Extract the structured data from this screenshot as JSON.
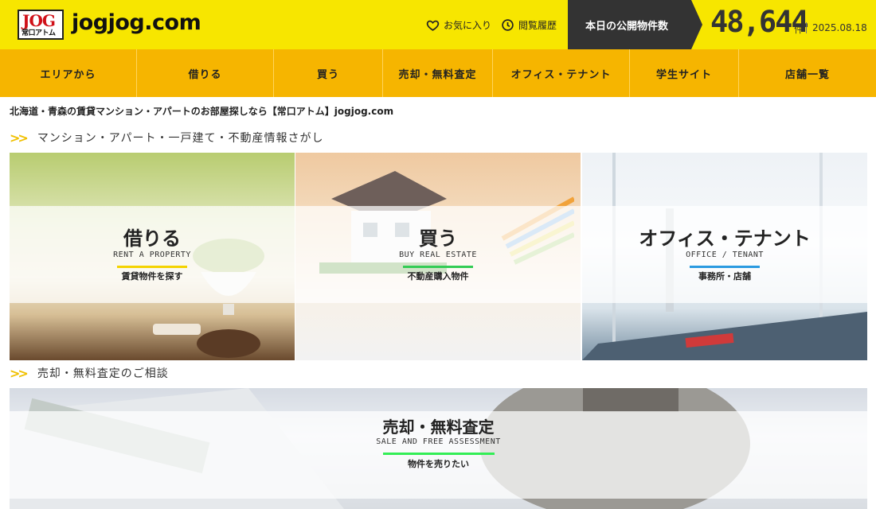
{
  "header": {
    "logo_text": "JOG",
    "logo_sub": "常口アトム",
    "site_name": "jogjog.com",
    "favorites": "お気に入り",
    "history": "閲覧履歴",
    "count_label": "本日の公開物件数",
    "count_value": "48,644",
    "count_unit": "件",
    "date": "2025.08.18"
  },
  "nav": [
    {
      "label": "エリアから"
    },
    {
      "label": "借りる"
    },
    {
      "label": "買う"
    },
    {
      "label": "売却・無料査定"
    },
    {
      "label": "オフィス・テナント"
    },
    {
      "label": "学生サイト"
    },
    {
      "label": "店舗一覧"
    }
  ],
  "lead": "北海道・青森の賃貸マンション・アパートのお部屋探しなら【常口アトム】jogjog.com",
  "section1": {
    "title": "マンション・アパート・一戸建て・不動産情報さがし"
  },
  "panels": [
    {
      "title": "借りる",
      "sub": "RENT A PROPERTY",
      "desc": "賃貸物件を探す",
      "bar_color": "#f4d300"
    },
    {
      "title": "買う",
      "sub": "BUY REAL ESTATE",
      "desc": "不動産購入物件",
      "bar_color": "#33cc55"
    },
    {
      "title": "オフィス・テナント",
      "sub": "OFFICE / TENANT",
      "desc": "事務所・店舗",
      "bar_color": "#2a9ae0"
    }
  ],
  "section2": {
    "title": "売却・無料査定のご相談"
  },
  "sale": {
    "title": "売却・無料査定",
    "sub": "SALE AND FREE ASSESSMENT",
    "desc": "物件を売りたい",
    "bar_color": "#33ee55"
  },
  "colors": {
    "header_bg": "#f7e600",
    "nav_bg": "#f6b500",
    "dark": "#333333",
    "chevron": "#f0c000"
  }
}
